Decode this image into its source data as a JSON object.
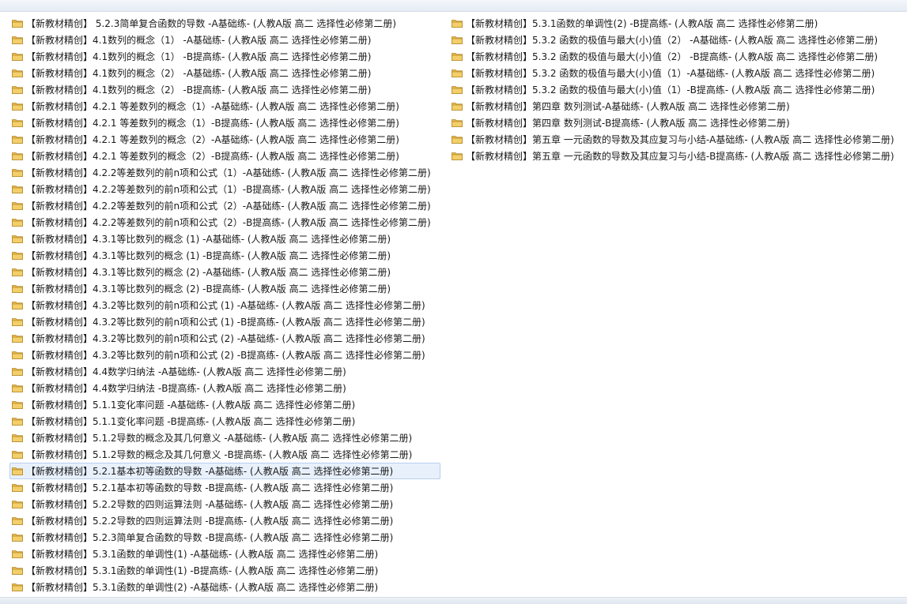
{
  "folder_icon": "folder-icon",
  "colors": {
    "folder": "#e8b84a",
    "selection": "#e8f0fb"
  },
  "left_items": [
    "【新教材精创】 5.2.3简单复合函数的导数 -A基础练- (人教A版 高二 选择性必修第二册)",
    "【新教材精创】4.1数列的概念（1） -A基础练- (人教A版 高二 选择性必修第二册)",
    "【新教材精创】4.1数列的概念（1） -B提高练- (人教A版 高二 选择性必修第二册)",
    "【新教材精创】4.1数列的概念（2） -A基础练- (人教A版 高二 选择性必修第二册)",
    "【新教材精创】4.1数列的概念（2） -B提高练- (人教A版 高二 选择性必修第二册)",
    "【新教材精创】4.2.1 等差数列的概念（1）-A基础练- (人教A版 高二 选择性必修第二册)",
    "【新教材精创】4.2.1 等差数列的概念（1）-B提高练- (人教A版 高二 选择性必修第二册)",
    "【新教材精创】4.2.1 等差数列的概念（2）-A基础练- (人教A版 高二 选择性必修第二册)",
    "【新教材精创】4.2.1 等差数列的概念（2）-B提高练- (人教A版 高二 选择性必修第二册)",
    "【新教材精创】4.2.2等差数列的前n项和公式（1）-A基础练- (人教A版 高二 选择性必修第二册)",
    "【新教材精创】4.2.2等差数列的前n项和公式（1）-B提高练- (人教A版 高二 选择性必修第二册)",
    "【新教材精创】4.2.2等差数列的前n项和公式（2）-A基础练- (人教A版 高二 选择性必修第二册)",
    "【新教材精创】4.2.2等差数列的前n项和公式（2）-B提高练- (人教A版 高二 选择性必修第二册)",
    "【新教材精创】4.3.1等比数列的概念 (1) -A基础练- (人教A版 高二 选择性必修第二册)",
    "【新教材精创】4.3.1等比数列的概念 (1) -B提高练- (人教A版 高二 选择性必修第二册)",
    "【新教材精创】4.3.1等比数列的概念 (2) -A基础练- (人教A版 高二 选择性必修第二册)",
    "【新教材精创】4.3.1等比数列的概念 (2) -B提高练- (人教A版 高二 选择性必修第二册)",
    "【新教材精创】4.3.2等比数列的前n项和公式 (1) -A基础练- (人教A版 高二 选择性必修第二册)",
    "【新教材精创】4.3.2等比数列的前n项和公式 (1) -B提高练- (人教A版 高二 选择性必修第二册)",
    "【新教材精创】4.3.2等比数列的前n项和公式 (2) -A基础练- (人教A版 高二 选择性必修第二册)",
    "【新教材精创】4.3.2等比数列的前n项和公式 (2) -B提高练- (人教A版 高二 选择性必修第二册)",
    "【新教材精创】4.4数学归纳法 -A基础练- (人教A版 高二 选择性必修第二册)",
    "【新教材精创】4.4数学归纳法 -B提高练- (人教A版 高二 选择性必修第二册)",
    "【新教材精创】5.1.1变化率问题 -A基础练- (人教A版 高二 选择性必修第二册)",
    "【新教材精创】5.1.1变化率问题 -B提高练- (人教A版 高二 选择性必修第二册)",
    "【新教材精创】5.1.2导数的概念及其几何意义 -A基础练- (人教A版 高二 选择性必修第二册)",
    "【新教材精创】5.1.2导数的概念及其几何意义 -B提高练- (人教A版 高二 选择性必修第二册)",
    "【新教材精创】5.2.1基本初等函数的导数 -A基础练- (人教A版 高二 选择性必修第二册)",
    "【新教材精创】5.2.1基本初等函数的导数 -B提高练- (人教A版 高二 选择性必修第二册)",
    "【新教材精创】5.2.2导数的四则运算法则 -A基础练- (人教A版 高二 选择性必修第二册)",
    "【新教材精创】5.2.2导数的四则运算法则 -B提高练- (人教A版 高二 选择性必修第二册)",
    "【新教材精创】5.2.3简单复合函数的导数 -B提高练- (人教A版 高二 选择性必修第二册)",
    "【新教材精创】5.3.1函数的单调性(1) -A基础练- (人教A版 高二 选择性必修第二册)",
    "【新教材精创】5.3.1函数的单调性(1) -B提高练- (人教A版 高二 选择性必修第二册)",
    "【新教材精创】5.3.1函数的单调性(2) -A基础练- (人教A版 高二 选择性必修第二册)"
  ],
  "right_items": [
    "【新教材精创】5.3.1函数的单调性(2) -B提高练- (人教A版 高二 选择性必修第二册)",
    "【新教材精创】5.3.2 函数的极值与最大(小)值（2） -A基础练- (人教A版 高二 选择性必修第二册)",
    "【新教材精创】5.3.2 函数的极值与最大(小)值（2） -B提高练- (人教A版 高二 选择性必修第二册)",
    "【新教材精创】5.3.2 函数的极值与最大(小)值（1）-A基础练- (人教A版 高二 选择性必修第二册)",
    "【新教材精创】5.3.2 函数的极值与最大(小)值（1）-B提高练- (人教A版 高二 选择性必修第二册)",
    "【新教材精创】第四章 数列测试-A基础练- (人教A版 高二 选择性必修第二册)",
    "【新教材精创】第四章 数列测试-B提高练- (人教A版 高二 选择性必修第二册)",
    "【新教材精创】第五章 一元函数的导数及其应复习与小结-A基础练- (人教A版 高二 选择性必修第二册)",
    "【新教材精创】第五章 一元函数的导数及其应复习与小结-B提高练- (人教A版 高二 选择性必修第二册)"
  ],
  "selected": {
    "column": "left",
    "index": 27
  }
}
